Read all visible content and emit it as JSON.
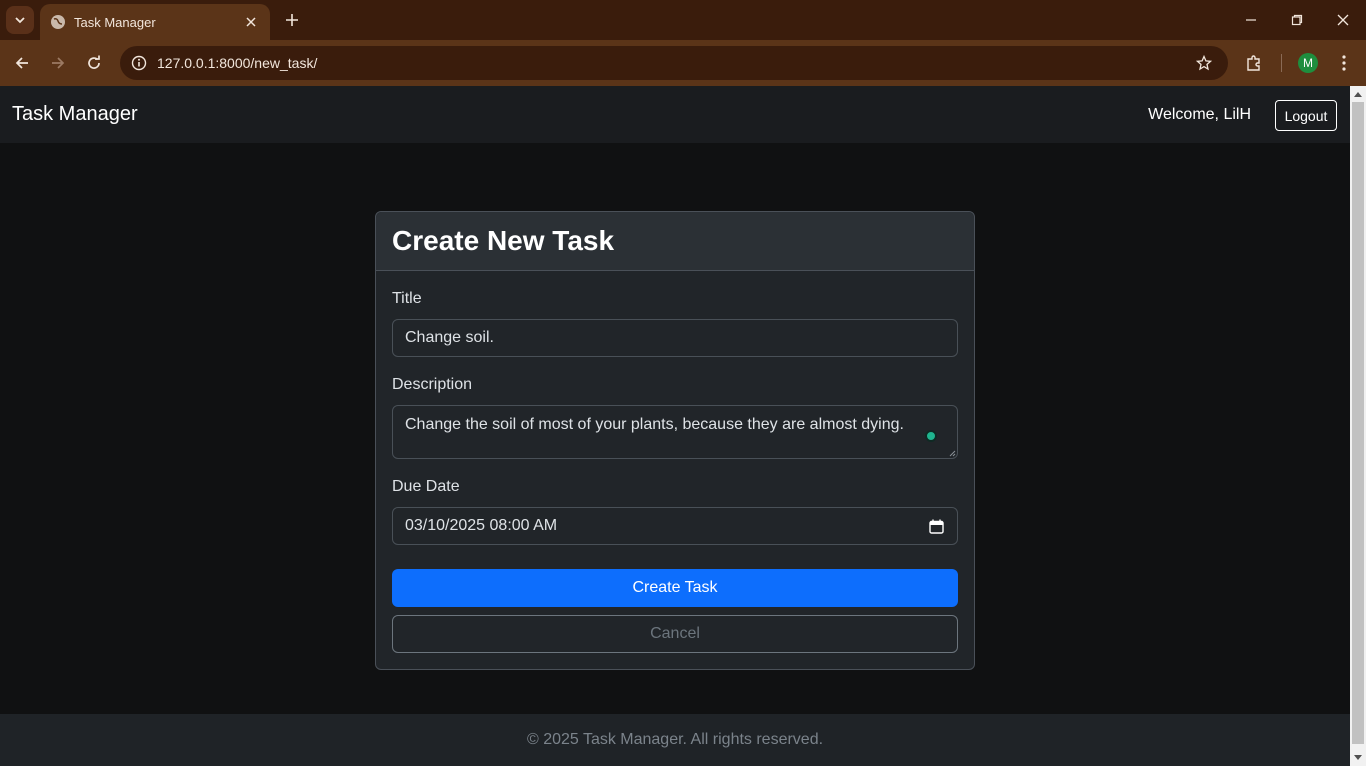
{
  "browser": {
    "tab_title": "Task Manager",
    "url": "127.0.0.1:8000/new_task/",
    "profile_initial": "M",
    "icons": [
      "tab-search-icon",
      "globe-icon",
      "close-icon",
      "plus-icon",
      "minimize-icon",
      "restore-icon",
      "close-window-icon",
      "back-arrow-icon",
      "forward-arrow-icon",
      "reload-icon",
      "info-icon",
      "star-icon",
      "extensions-icon",
      "more-vert-icon"
    ]
  },
  "navbar": {
    "brand": "Task Manager",
    "welcome": "Welcome, LilH",
    "logout_label": "Logout"
  },
  "form": {
    "heading": "Create New Task",
    "title_label": "Title",
    "title_value": "Change soil.",
    "description_label": "Description",
    "description_value": "Change the soil of most of your plants, because they are almost dying.",
    "due_date_label": "Due Date",
    "due_date_value": "03/10/2025 08:00  AM",
    "submit_label": "Create Task",
    "cancel_label": "Cancel"
  },
  "footer": {
    "text": "© 2025 Task Manager. All rights reserved."
  },
  "colors": {
    "tabbar": "#3a1c0c",
    "toolbar": "#5b3418",
    "page_bg": "#101112",
    "navbar_bg": "#1a1c1f",
    "card_bg": "#212529",
    "primary": "#0d6efd",
    "footer_bg": "#1f2327"
  }
}
